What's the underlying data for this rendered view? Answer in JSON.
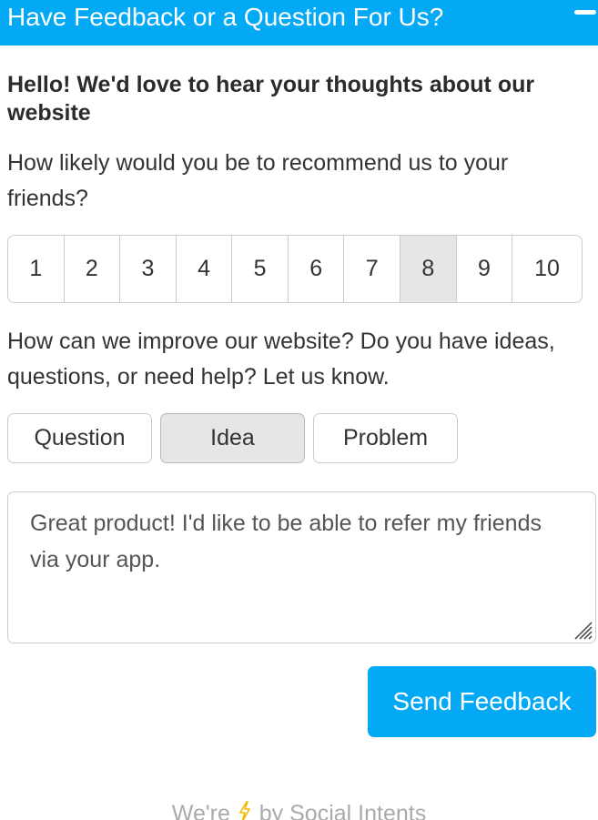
{
  "header": {
    "title": "Have Feedback or a Question For Us?",
    "minimize_icon": "minus-icon",
    "color": "#03a9f4"
  },
  "intro": "Hello! We'd love to hear your thoughts about our website",
  "recommend": {
    "question": "How likely would you be to recommend us to your friends?",
    "options": [
      "1",
      "2",
      "3",
      "4",
      "5",
      "6",
      "7",
      "8",
      "9",
      "10"
    ],
    "selected": "8"
  },
  "improve": {
    "question": "How can we improve our website? Do you have ideas, questions, or need help? Let us know.",
    "types": [
      "Question",
      "Idea",
      "Problem"
    ],
    "selected": "Idea"
  },
  "message": {
    "value": "Great product!  I'd like to be able to refer my friends via your app."
  },
  "send_button": {
    "label": "Send Feedback",
    "color": "#03a9f4"
  },
  "footer": {
    "prefix": "We're",
    "icon": "lightning-bolt-icon",
    "suffix": "by Social Intents",
    "icon_color": "#f5b800"
  }
}
